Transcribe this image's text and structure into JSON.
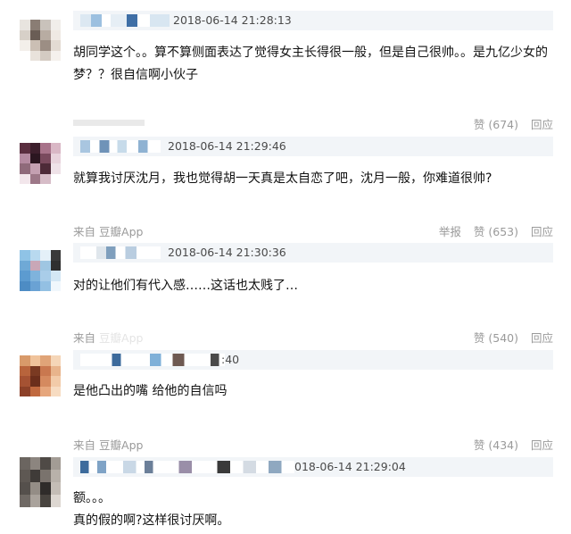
{
  "comments": [
    {
      "timestamp": "2018-06-14 21:28:13",
      "lines": [
        "胡同学这个。。算不算侧面表达了觉得女主长得很一般，但是自己很帅。。是九亿少女的",
        "梦？？很自信啊小伙子"
      ],
      "source_prefix": "",
      "source_app": "",
      "report_label": "",
      "like_label": "赞 (674)",
      "reply_label": "回应",
      "avatar_colors": [
        "#e8e4df",
        "#8a7d74",
        "#c9c2bb",
        "#f1eeea",
        "#d7d0c8",
        "#6a5d55",
        "#b8aca2",
        "#efe9e3",
        "#f3efea",
        "#cbbfb4",
        "#9c8e84",
        "#e3dbd3",
        "#ffffff",
        "#e9e2db",
        "#d4cbc2",
        "#f5f1ed"
      ]
    },
    {
      "timestamp": "2018-06-14 21:29:46",
      "lines": [
        "就算我讨厌沈月，我也觉得胡一天真是太自恋了吧，沈月一般，你难道很帅?"
      ],
      "source_prefix": "来自",
      "source_app": "豆瓣App",
      "report_label": "举报",
      "like_label": "赞 (653)",
      "reply_label": "回应",
      "avatar_colors": [
        "#5a2e3f",
        "#3d1f2c",
        "#a8738a",
        "#d9b7c5",
        "#b48aa0",
        "#2b1620",
        "#7a4a5e",
        "#e8d3dc",
        "#8f6a7a",
        "#c4a0b1",
        "#4d2a38",
        "#efe2e8",
        "#f2e6eb",
        "#9d7888",
        "#d6bcc7",
        "#ffffff"
      ]
    },
    {
      "timestamp": "2018-06-14 21:30:36",
      "lines": [
        "对的让他们有代入感……这话也太贱了…"
      ],
      "source_prefix": "来自",
      "source_app": "豆瓣App",
      "report_label": "",
      "like_label": "赞 (540)",
      "reply_label": "回应",
      "avatar_colors": [
        "#8fc3e6",
        "#b8d9ef",
        "#e4f0f8",
        "#3a3a3a",
        "#6fa9d6",
        "#c9a7b7",
        "#9fc6e2",
        "#2f2f2f",
        "#5c9bd0",
        "#7fb3dc",
        "#a9cde9",
        "#d4e7f4",
        "#4d8cc4",
        "#6aa2d4",
        "#93c0e3",
        "#f0f7fc"
      ]
    },
    {
      "timestamp": ":40",
      "lines": [
        "是他凸出的嘴 给他的自信吗"
      ],
      "source_prefix": "来自",
      "source_app": "豆瓣App",
      "report_label": "",
      "like_label": "赞 (434)",
      "reply_label": "回应",
      "avatar_colors": [
        "#d89a6a",
        "#f0c39b",
        "#e0a478",
        "#f5d6b8",
        "#b8643c",
        "#7a3a22",
        "#c9784f",
        "#e8b48c",
        "#a55233",
        "#6b2e1b",
        "#d58a5f",
        "#f2cba9",
        "#8c4128",
        "#c0693f",
        "#e6a67c",
        "#f7dcc2"
      ]
    },
    {
      "timestamp": "018-06-14 21:29:04",
      "lines": [
        "额。。。",
        "真的假的啊?这样很讨厌啊。"
      ],
      "source_prefix": "",
      "source_app": "",
      "report_label": "",
      "like_label": "",
      "reply_label": "",
      "avatar_colors": [
        "#6b6560",
        "#8c857f",
        "#4f4a46",
        "#a39c95",
        "#5e5853",
        "#3f3b38",
        "#7a736d",
        "#b8b1aa",
        "#55504c",
        "#948d86",
        "#2f2c2a",
        "#c4bdb6",
        "#6f6964",
        "#aaa39c",
        "#48443f",
        "#ddd7d1"
      ]
    }
  ]
}
